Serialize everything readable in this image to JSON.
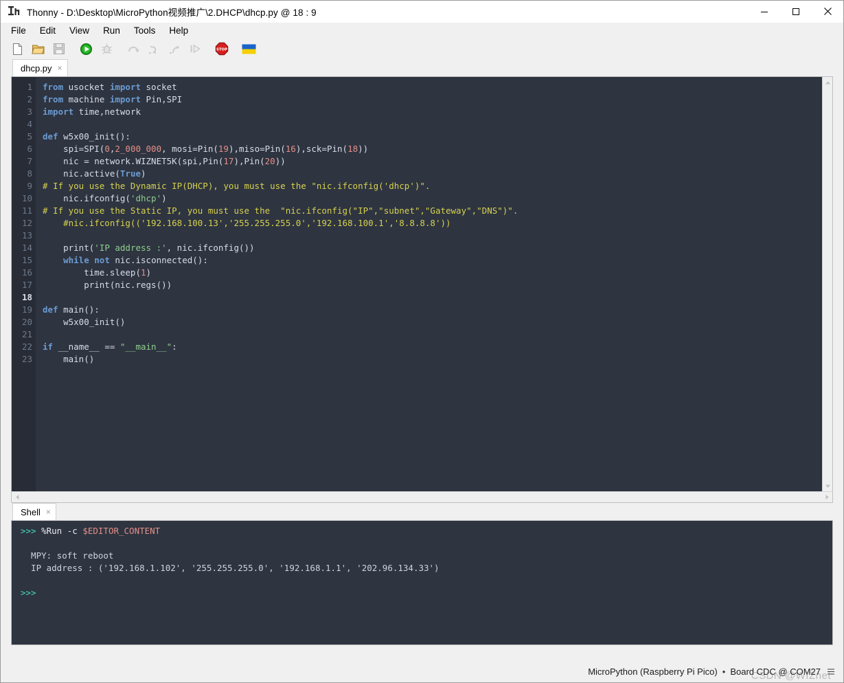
{
  "window": {
    "title": "Thonny  -  D:\\Desktop\\MicroPython视频推广\\2.DHCP\\dhcp.py  @  18 : 9",
    "icon": "thonny-logo-icon",
    "minimize_label": "Minimize",
    "maximize_label": "Maximize",
    "close_label": "Close"
  },
  "menu": {
    "items": [
      {
        "label": "File"
      },
      {
        "label": "Edit"
      },
      {
        "label": "View"
      },
      {
        "label": "Run"
      },
      {
        "label": "Tools"
      },
      {
        "label": "Help"
      }
    ]
  },
  "toolbar": {
    "buttons": [
      {
        "name": "new-file-icon",
        "label": "New",
        "enabled": true
      },
      {
        "name": "open-file-icon",
        "label": "Load",
        "enabled": true
      },
      {
        "name": "save-file-icon",
        "label": "Save",
        "enabled": false
      },
      {
        "name": "run-icon",
        "label": "Run current script",
        "enabled": true
      },
      {
        "name": "debug-icon",
        "label": "Debug current script",
        "enabled": false
      },
      {
        "name": "step-over-icon",
        "label": "Step over",
        "enabled": false
      },
      {
        "name": "step-into-icon",
        "label": "Step into",
        "enabled": false
      },
      {
        "name": "step-out-icon",
        "label": "Step out",
        "enabled": false
      },
      {
        "name": "resume-icon",
        "label": "Resume",
        "enabled": false
      },
      {
        "name": "stop-icon",
        "label": "Stop/Restart backend",
        "enabled": true
      },
      {
        "name": "ukraine-flag-icon",
        "label": "Support Ukraine",
        "enabled": true
      }
    ]
  },
  "editor": {
    "tab": {
      "label": "dhcp.py",
      "close": "×"
    },
    "current_line": 18,
    "lines": [
      {
        "n": 1,
        "tokens": [
          {
            "t": "from",
            "c": "kw"
          },
          {
            "t": " usocket ",
            "c": "plain"
          },
          {
            "t": "import",
            "c": "kw"
          },
          {
            "t": " socket",
            "c": "plain"
          }
        ]
      },
      {
        "n": 2,
        "tokens": [
          {
            "t": "from",
            "c": "kw"
          },
          {
            "t": " machine ",
            "c": "plain"
          },
          {
            "t": "import",
            "c": "kw"
          },
          {
            "t": " Pin,SPI",
            "c": "plain"
          }
        ]
      },
      {
        "n": 3,
        "tokens": [
          {
            "t": "import",
            "c": "kw"
          },
          {
            "t": " time,network",
            "c": "plain"
          }
        ]
      },
      {
        "n": 4,
        "tokens": []
      },
      {
        "n": 5,
        "tokens": [
          {
            "t": "def",
            "c": "kw"
          },
          {
            "t": " w5x00_init():",
            "c": "plain"
          }
        ]
      },
      {
        "n": 6,
        "tokens": [
          {
            "t": "    spi=SPI(",
            "c": "plain"
          },
          {
            "t": "0",
            "c": "num"
          },
          {
            "t": ",",
            "c": "plain"
          },
          {
            "t": "2_000_000",
            "c": "num"
          },
          {
            "t": ", mosi=Pin(",
            "c": "plain"
          },
          {
            "t": "19",
            "c": "num"
          },
          {
            "t": "),miso=Pin(",
            "c": "plain"
          },
          {
            "t": "16",
            "c": "num"
          },
          {
            "t": "),sck=Pin(",
            "c": "plain"
          },
          {
            "t": "18",
            "c": "num"
          },
          {
            "t": "))",
            "c": "plain"
          }
        ]
      },
      {
        "n": 7,
        "tokens": [
          {
            "t": "    nic = network.WIZNET5K(spi,Pin(",
            "c": "plain"
          },
          {
            "t": "17",
            "c": "num"
          },
          {
            "t": "),Pin(",
            "c": "plain"
          },
          {
            "t": "20",
            "c": "num"
          },
          {
            "t": "))",
            "c": "plain"
          }
        ]
      },
      {
        "n": 8,
        "tokens": [
          {
            "t": "    nic.active(",
            "c": "plain"
          },
          {
            "t": "True",
            "c": "kw"
          },
          {
            "t": ")",
            "c": "plain"
          }
        ]
      },
      {
        "n": 9,
        "tokens": [
          {
            "t": "# If you use the Dynamic IP(DHCP), you must use the \"nic.ifconfig('dhcp')\".",
            "c": "com"
          }
        ]
      },
      {
        "n": 10,
        "tokens": [
          {
            "t": "    nic.ifconfig(",
            "c": "plain"
          },
          {
            "t": "'dhcp'",
            "c": "str"
          },
          {
            "t": ")",
            "c": "plain"
          }
        ]
      },
      {
        "n": 11,
        "tokens": [
          {
            "t": "# If you use the Static IP, you must use the  \"nic.ifconfig(\"IP\",\"subnet\",\"Gateway\",\"DNS\")\".",
            "c": "com"
          }
        ]
      },
      {
        "n": 12,
        "tokens": [
          {
            "t": "    #nic.ifconfig(('192.168.100.13','255.255.255.0','192.168.100.1','8.8.8.8'))",
            "c": "com"
          }
        ]
      },
      {
        "n": 13,
        "tokens": []
      },
      {
        "n": 14,
        "tokens": [
          {
            "t": "    print(",
            "c": "plain"
          },
          {
            "t": "'IP address :'",
            "c": "str"
          },
          {
            "t": ", nic.ifconfig())",
            "c": "plain"
          }
        ]
      },
      {
        "n": 15,
        "tokens": [
          {
            "t": "    ",
            "c": "plain"
          },
          {
            "t": "while",
            "c": "kw"
          },
          {
            "t": " ",
            "c": "plain"
          },
          {
            "t": "not",
            "c": "kw"
          },
          {
            "t": " nic.isconnected():",
            "c": "plain"
          }
        ]
      },
      {
        "n": 16,
        "tokens": [
          {
            "t": "        time.sleep(",
            "c": "plain"
          },
          {
            "t": "1",
            "c": "num"
          },
          {
            "t": ")",
            "c": "plain"
          }
        ]
      },
      {
        "n": 17,
        "tokens": [
          {
            "t": "        print(nic.regs())",
            "c": "plain"
          }
        ]
      },
      {
        "n": 18,
        "tokens": []
      },
      {
        "n": 19,
        "tokens": [
          {
            "t": "def",
            "c": "kw"
          },
          {
            "t": " main():",
            "c": "plain"
          }
        ]
      },
      {
        "n": 20,
        "tokens": [
          {
            "t": "    w5x00_init()",
            "c": "plain"
          }
        ]
      },
      {
        "n": 21,
        "tokens": []
      },
      {
        "n": 22,
        "tokens": [
          {
            "t": "if",
            "c": "kw"
          },
          {
            "t": " __name__ == ",
            "c": "plain"
          },
          {
            "t": "\"__main__\"",
            "c": "str"
          },
          {
            "t": ":",
            "c": "plain"
          }
        ]
      },
      {
        "n": 23,
        "tokens": [
          {
            "t": "    main()",
            "c": "plain"
          }
        ]
      }
    ]
  },
  "shell": {
    "tab": {
      "label": "Shell",
      "close": "×"
    },
    "lines": [
      {
        "segments": [
          {
            "t": ">>> ",
            "c": "prompt"
          },
          {
            "t": "%Run -c ",
            "c": "cmd"
          },
          {
            "t": "$EDITOR_CONTENT",
            "c": "var"
          }
        ]
      },
      {
        "segments": []
      },
      {
        "segments": [
          {
            "t": "  MPY: soft reboot",
            "c": "out"
          }
        ]
      },
      {
        "segments": [
          {
            "t": "  IP address : ('192.168.1.102', '255.255.255.0', '192.168.1.1', '202.96.134.33')",
            "c": "out"
          }
        ]
      },
      {
        "segments": []
      },
      {
        "segments": [
          {
            "t": ">>>",
            "c": "prompt"
          }
        ]
      }
    ]
  },
  "statusbar": {
    "interpreter": "MicroPython (Raspberry Pi Pico)",
    "separator": "•",
    "connection": "Board CDC @ COM27",
    "menu_icon": "hamburger-menu-icon",
    "watermark": "CSDN @WIZnet"
  }
}
